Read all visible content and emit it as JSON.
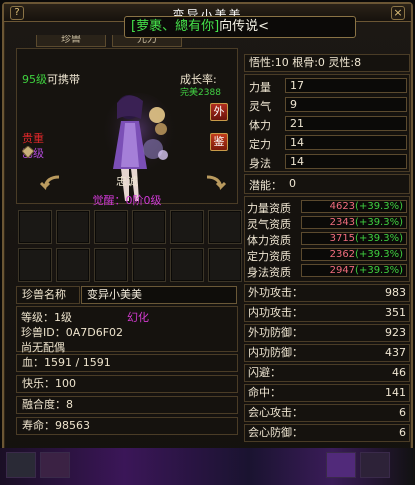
{
  "window": {
    "title": "变异小美美",
    "help_label": "?",
    "close_label": "×",
    "banner_left": "[",
    "banner_text": "萝裹、總有你",
    "banner_mid": "]",
    "banner_right": "向传说<"
  },
  "tabs": [
    "珍兽",
    "元力"
  ],
  "pet": {
    "level_green": "95级",
    "level_white": "可携带",
    "growth_label": "成长率:",
    "growth_quality": "完美",
    "growth_value": "2388",
    "quality_top": "贵重",
    "quality_bottom": "乙级",
    "btn_wai": "外",
    "btn_jian": "鉴",
    "name_label": "忠诚",
    "awaken": "觉醒：0阶0级"
  },
  "slots_rows": 2,
  "slots_cols": 6,
  "info": {
    "name_label": "珍兽名称",
    "name_value": "变异小美美",
    "level": "等级：1级",
    "id": "珍兽ID：0A7D6F02",
    "mate": "尚无配偶",
    "huanhua": "幻化",
    "hp": "血：1591 / 1591",
    "happiness": "快乐：100",
    "fusion": "融合度：8",
    "lifespan": "寿命：98563"
  },
  "right_head": {
    "wuxing": "悟性:10",
    "gengu": "根骨:0",
    "lingxing": "灵性:8"
  },
  "attributes": [
    {
      "label": "力量",
      "value": "17"
    },
    {
      "label": "灵气",
      "value": "9"
    },
    {
      "label": "体力",
      "value": "21"
    },
    {
      "label": "定力",
      "value": "14"
    },
    {
      "label": "身法",
      "value": "14"
    }
  ],
  "potential": {
    "label": "潜能：",
    "value": "0"
  },
  "aptitudes": [
    {
      "label": "力量资质",
      "value": "4623",
      "bonus": "(+39.3%)"
    },
    {
      "label": "灵气资质",
      "value": "2343",
      "bonus": "(+39.3%)"
    },
    {
      "label": "体力资质",
      "value": "3715",
      "bonus": "(+39.3%)"
    },
    {
      "label": "定力资质",
      "value": "2362",
      "bonus": "(+39.3%)"
    },
    {
      "label": "身法资质",
      "value": "2947",
      "bonus": "(+39.3%)"
    }
  ],
  "combat": [
    {
      "label": "外功攻击：",
      "value": "983"
    },
    {
      "label": "内功攻击：",
      "value": "351"
    },
    {
      "label": "外功防御：",
      "value": "923"
    },
    {
      "label": "内功防御：",
      "value": "437"
    },
    {
      "label": "闪避：",
      "value": "46"
    },
    {
      "label": "命中：",
      "value": "141"
    },
    {
      "label": "会心攻击：",
      "value": "6"
    },
    {
      "label": "会心防御：",
      "value": "6"
    }
  ],
  "colors": {
    "frame": "#6b5634",
    "green": "#3fd13f",
    "red": "#e0272a",
    "purple": "#b04ad8",
    "aptitude_value": "#f06d7e"
  }
}
